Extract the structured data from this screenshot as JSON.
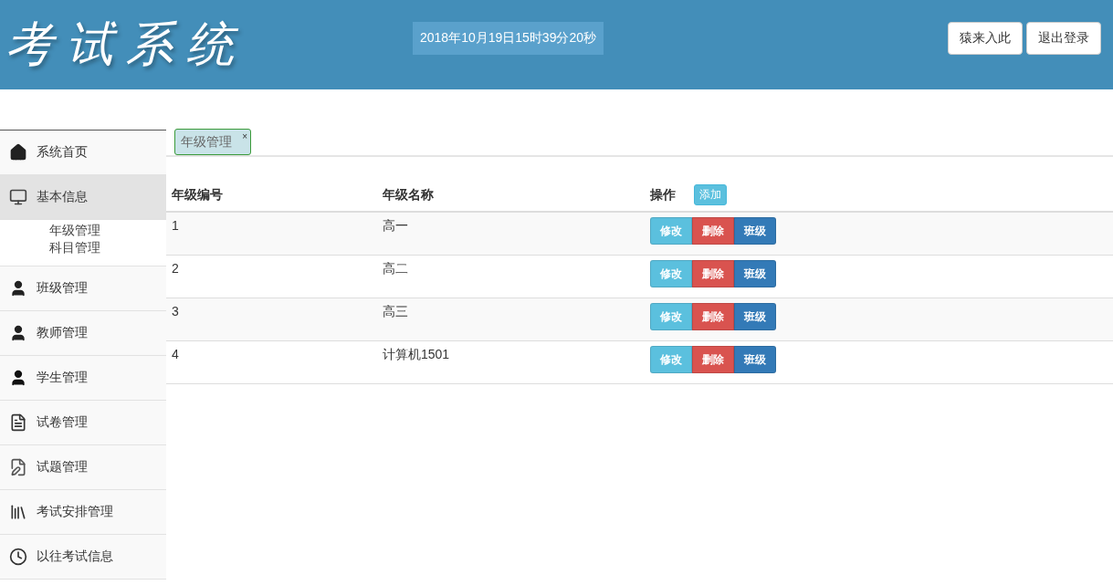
{
  "header": {
    "logo": "考试系统",
    "datetime": "2018年10月19日15时39分20秒",
    "buttons": [
      "猿来入此",
      "退出登录"
    ]
  },
  "sidebar": {
    "items": [
      {
        "label": "系统首页",
        "kind": "home",
        "selected": false
      },
      {
        "label": "基本信息",
        "kind": "monitor",
        "selected": true,
        "children": [
          {
            "label": "年级管理"
          },
          {
            "label": "科目管理"
          }
        ]
      },
      {
        "label": "班级管理",
        "kind": "person",
        "selected": false
      },
      {
        "label": "教师管理",
        "kind": "person",
        "selected": false
      },
      {
        "label": "学生管理",
        "kind": "student",
        "selected": false
      },
      {
        "label": "试卷管理",
        "kind": "paper",
        "selected": false
      },
      {
        "label": "试题管理",
        "kind": "exam",
        "selected": false
      },
      {
        "label": "考试安排管理",
        "kind": "books",
        "selected": false
      },
      {
        "label": "以往考试信息",
        "kind": "clock",
        "selected": false
      }
    ]
  },
  "tabs": [
    {
      "label": "年级管理",
      "close": "×"
    }
  ],
  "table": {
    "columns": [
      "年级编号",
      "年级名称",
      "操作"
    ],
    "add_button": "添加",
    "rows": [
      {
        "id": "1",
        "name": "高一",
        "actions": [
          "修改",
          "删除",
          "班级"
        ]
      },
      {
        "id": "2",
        "name": "高二",
        "actions": [
          "修改",
          "删除",
          "班级"
        ]
      },
      {
        "id": "3",
        "name": "高三",
        "actions": [
          "修改",
          "删除",
          "班级"
        ]
      },
      {
        "id": "4",
        "name": "计算机1501",
        "actions": [
          "修改",
          "删除",
          "班级"
        ]
      }
    ]
  }
}
